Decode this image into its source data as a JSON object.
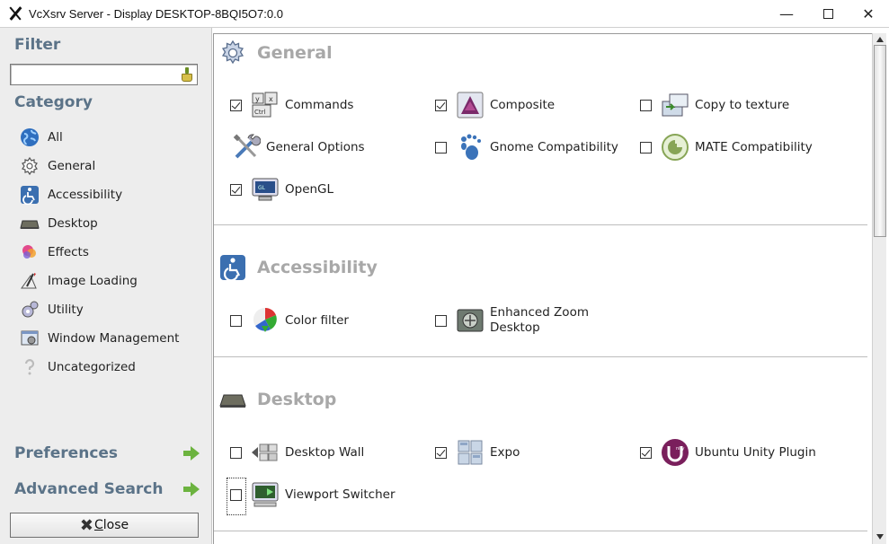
{
  "window": {
    "title": "VcXsrv Server - Display DESKTOP-8BQI5O7:0.0",
    "minimize_glyph": "—",
    "close_glyph": "✕"
  },
  "sidebar": {
    "filter_heading": "Filter",
    "filter_value": "",
    "category_heading": "Category",
    "categories": [
      {
        "label": "All",
        "icon": "globe-icon"
      },
      {
        "label": "General",
        "icon": "gear-icon"
      },
      {
        "label": "Accessibility",
        "icon": "accessibility-icon"
      },
      {
        "label": "Desktop",
        "icon": "desktop-icon"
      },
      {
        "label": "Effects",
        "icon": "effects-icon"
      },
      {
        "label": "Image Loading",
        "icon": "image-loading-icon"
      },
      {
        "label": "Utility",
        "icon": "utility-icon"
      },
      {
        "label": "Window Management",
        "icon": "window-management-icon"
      },
      {
        "label": "Uncategorized",
        "icon": "question-icon"
      }
    ],
    "preferences_label": "Preferences",
    "advanced_search_label": "Advanced Search",
    "close_label": "Close"
  },
  "sections": {
    "general": {
      "title": "General",
      "plugins": [
        {
          "label": "Commands",
          "checked": true
        },
        {
          "label": "Composite",
          "checked": true
        },
        {
          "label": "Copy to texture",
          "checked": false
        },
        {
          "label": "General Options"
        },
        {
          "label": "Gnome Compatibility",
          "checked": false
        },
        {
          "label": "MATE Compatibility",
          "checked": false
        },
        {
          "label": "OpenGL",
          "checked": true
        }
      ]
    },
    "accessibility": {
      "title": "Accessibility",
      "plugins": [
        {
          "label": "Color filter",
          "checked": false
        },
        {
          "label": "Enhanced Zoom Desktop",
          "checked": false
        }
      ]
    },
    "desktop": {
      "title": "Desktop",
      "plugins": [
        {
          "label": "Desktop Wall",
          "checked": false
        },
        {
          "label": "Expo",
          "checked": true
        },
        {
          "label": "Ubuntu Unity Plugin",
          "checked": true
        },
        {
          "label": "Viewport Switcher",
          "checked": false
        }
      ]
    }
  },
  "colors": {
    "heading_blue": "#5b7388",
    "section_title_gray": "#a8a8a8",
    "sidebar_bg": "#ededed",
    "arrow_green": "#6cb33f"
  }
}
